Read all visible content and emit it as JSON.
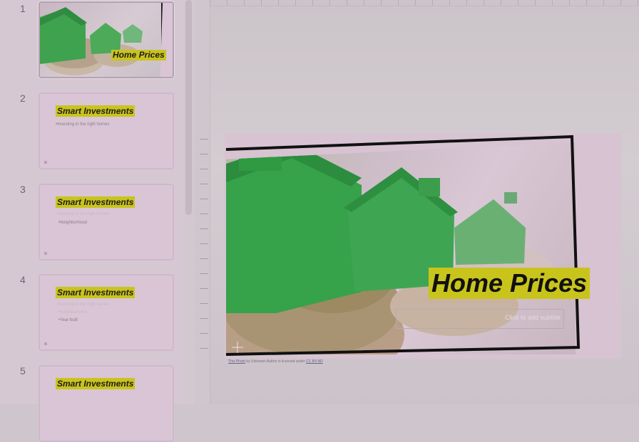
{
  "thumbnails": [
    {
      "number": "1",
      "title": "Home Prices",
      "bullets": []
    },
    {
      "number": "2",
      "title": "Smart Investments",
      "bullets": [
        "•Investing in the right homes"
      ]
    },
    {
      "number": "3",
      "title": "Smart Investments",
      "bullets": [
        "Investing in the right homes",
        "•Neighborhood"
      ]
    },
    {
      "number": "4",
      "title": "Smart Investments",
      "bullets": [
        "Investing in the right homes",
        "•Neighborhood",
        "•Year built"
      ]
    },
    {
      "number": "5",
      "title": "Smart Investments",
      "bullets": []
    }
  ],
  "slide": {
    "title": "Home Prices",
    "subtitle_placeholder": "Click to add subtitle",
    "attribution": {
      "link1": "This Photo",
      "middle": " by Unknown Author is licensed under ",
      "link2": "CC BY-ND"
    },
    "photo_note": "green toy houses on coins"
  },
  "colors": {
    "title_highlight": "#c9c41c",
    "thumb_background": "#d9c5d5",
    "slide_background": "#d7c3d2",
    "photo_frame": "#111111",
    "house_green": "#38b54a"
  },
  "icons": {
    "zoom": "crosshair-icon"
  }
}
